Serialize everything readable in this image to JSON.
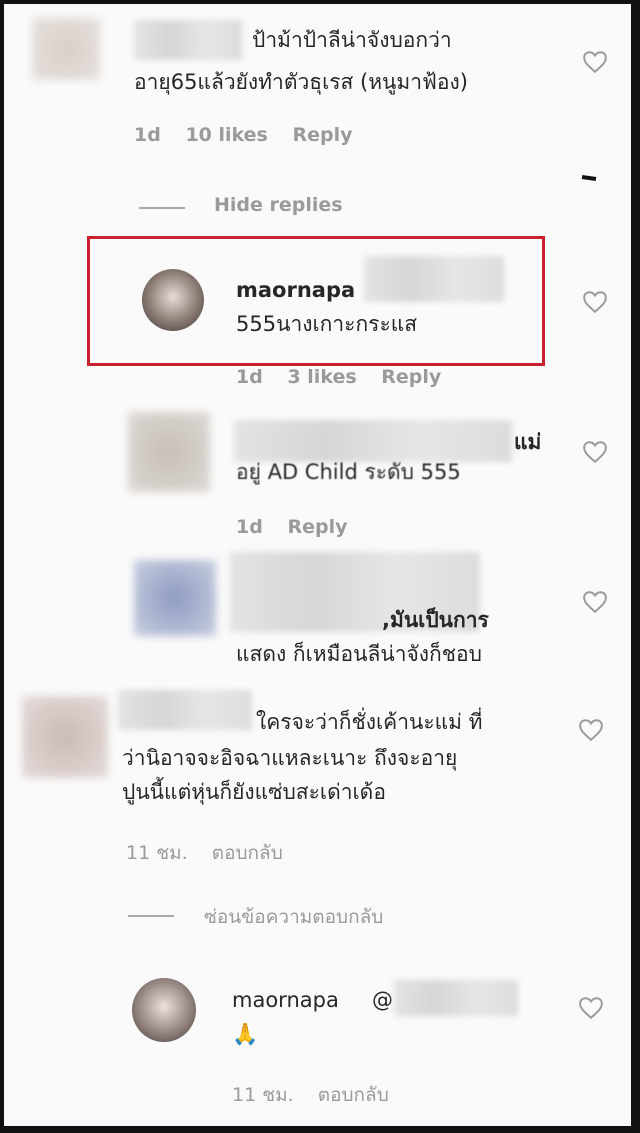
{
  "comments": [
    {
      "text_line1": "ป้าม้าป้าลีน่าจังบอกว่า",
      "text_line2": "อายุ65แล้วยังทำตัวธุเรส (หนูมาฟ้อง)",
      "meta_time": "1d",
      "meta_likes": "10 likes",
      "meta_reply": "Reply"
    },
    {
      "hide_replies": "Hide replies"
    },
    {
      "username": "maornapa",
      "text": "555นางเกาะกระแส",
      "meta_time": "1d",
      "meta_likes": "3 likes",
      "meta_reply": "Reply"
    },
    {
      "text_line1_suffix": "แม่",
      "text_line2": "อยู่ AD Child ระดับ 555",
      "meta_time": "1d",
      "meta_reply": "Reply"
    },
    {
      "text_line1_suffix": ",มันเป็นการ",
      "text_line2": "แสดง ก็เหมือนลีน่าจังก็ชอบ"
    },
    {
      "text_line1": "ใครจะว่าก็ชั่งเค้านะแม่ ที่",
      "text_line2": "ว่านิอาจจะอิจฉาแหละเนาะ ถึงจะอายุ",
      "text_line3": "ปูนนี้แต่หุ่นก็ยังแซ่บสะเด่าเด้อ",
      "meta_time": "11 ชม.",
      "meta_reply": "ตอบกลับ"
    },
    {
      "hide_replies": "ซ่อนข้อความตอบกลับ"
    },
    {
      "username": "maornapa",
      "mention": "@",
      "emoji": "🙏",
      "meta_time": "11 ชม.",
      "meta_reply": "ตอบกลับ"
    }
  ],
  "colors": {
    "highlight": "#c8202e",
    "text": "#262626",
    "meta": "#9a9a9a",
    "background": "#fafafa"
  },
  "icons": {
    "like": "heart-outline-icon"
  }
}
